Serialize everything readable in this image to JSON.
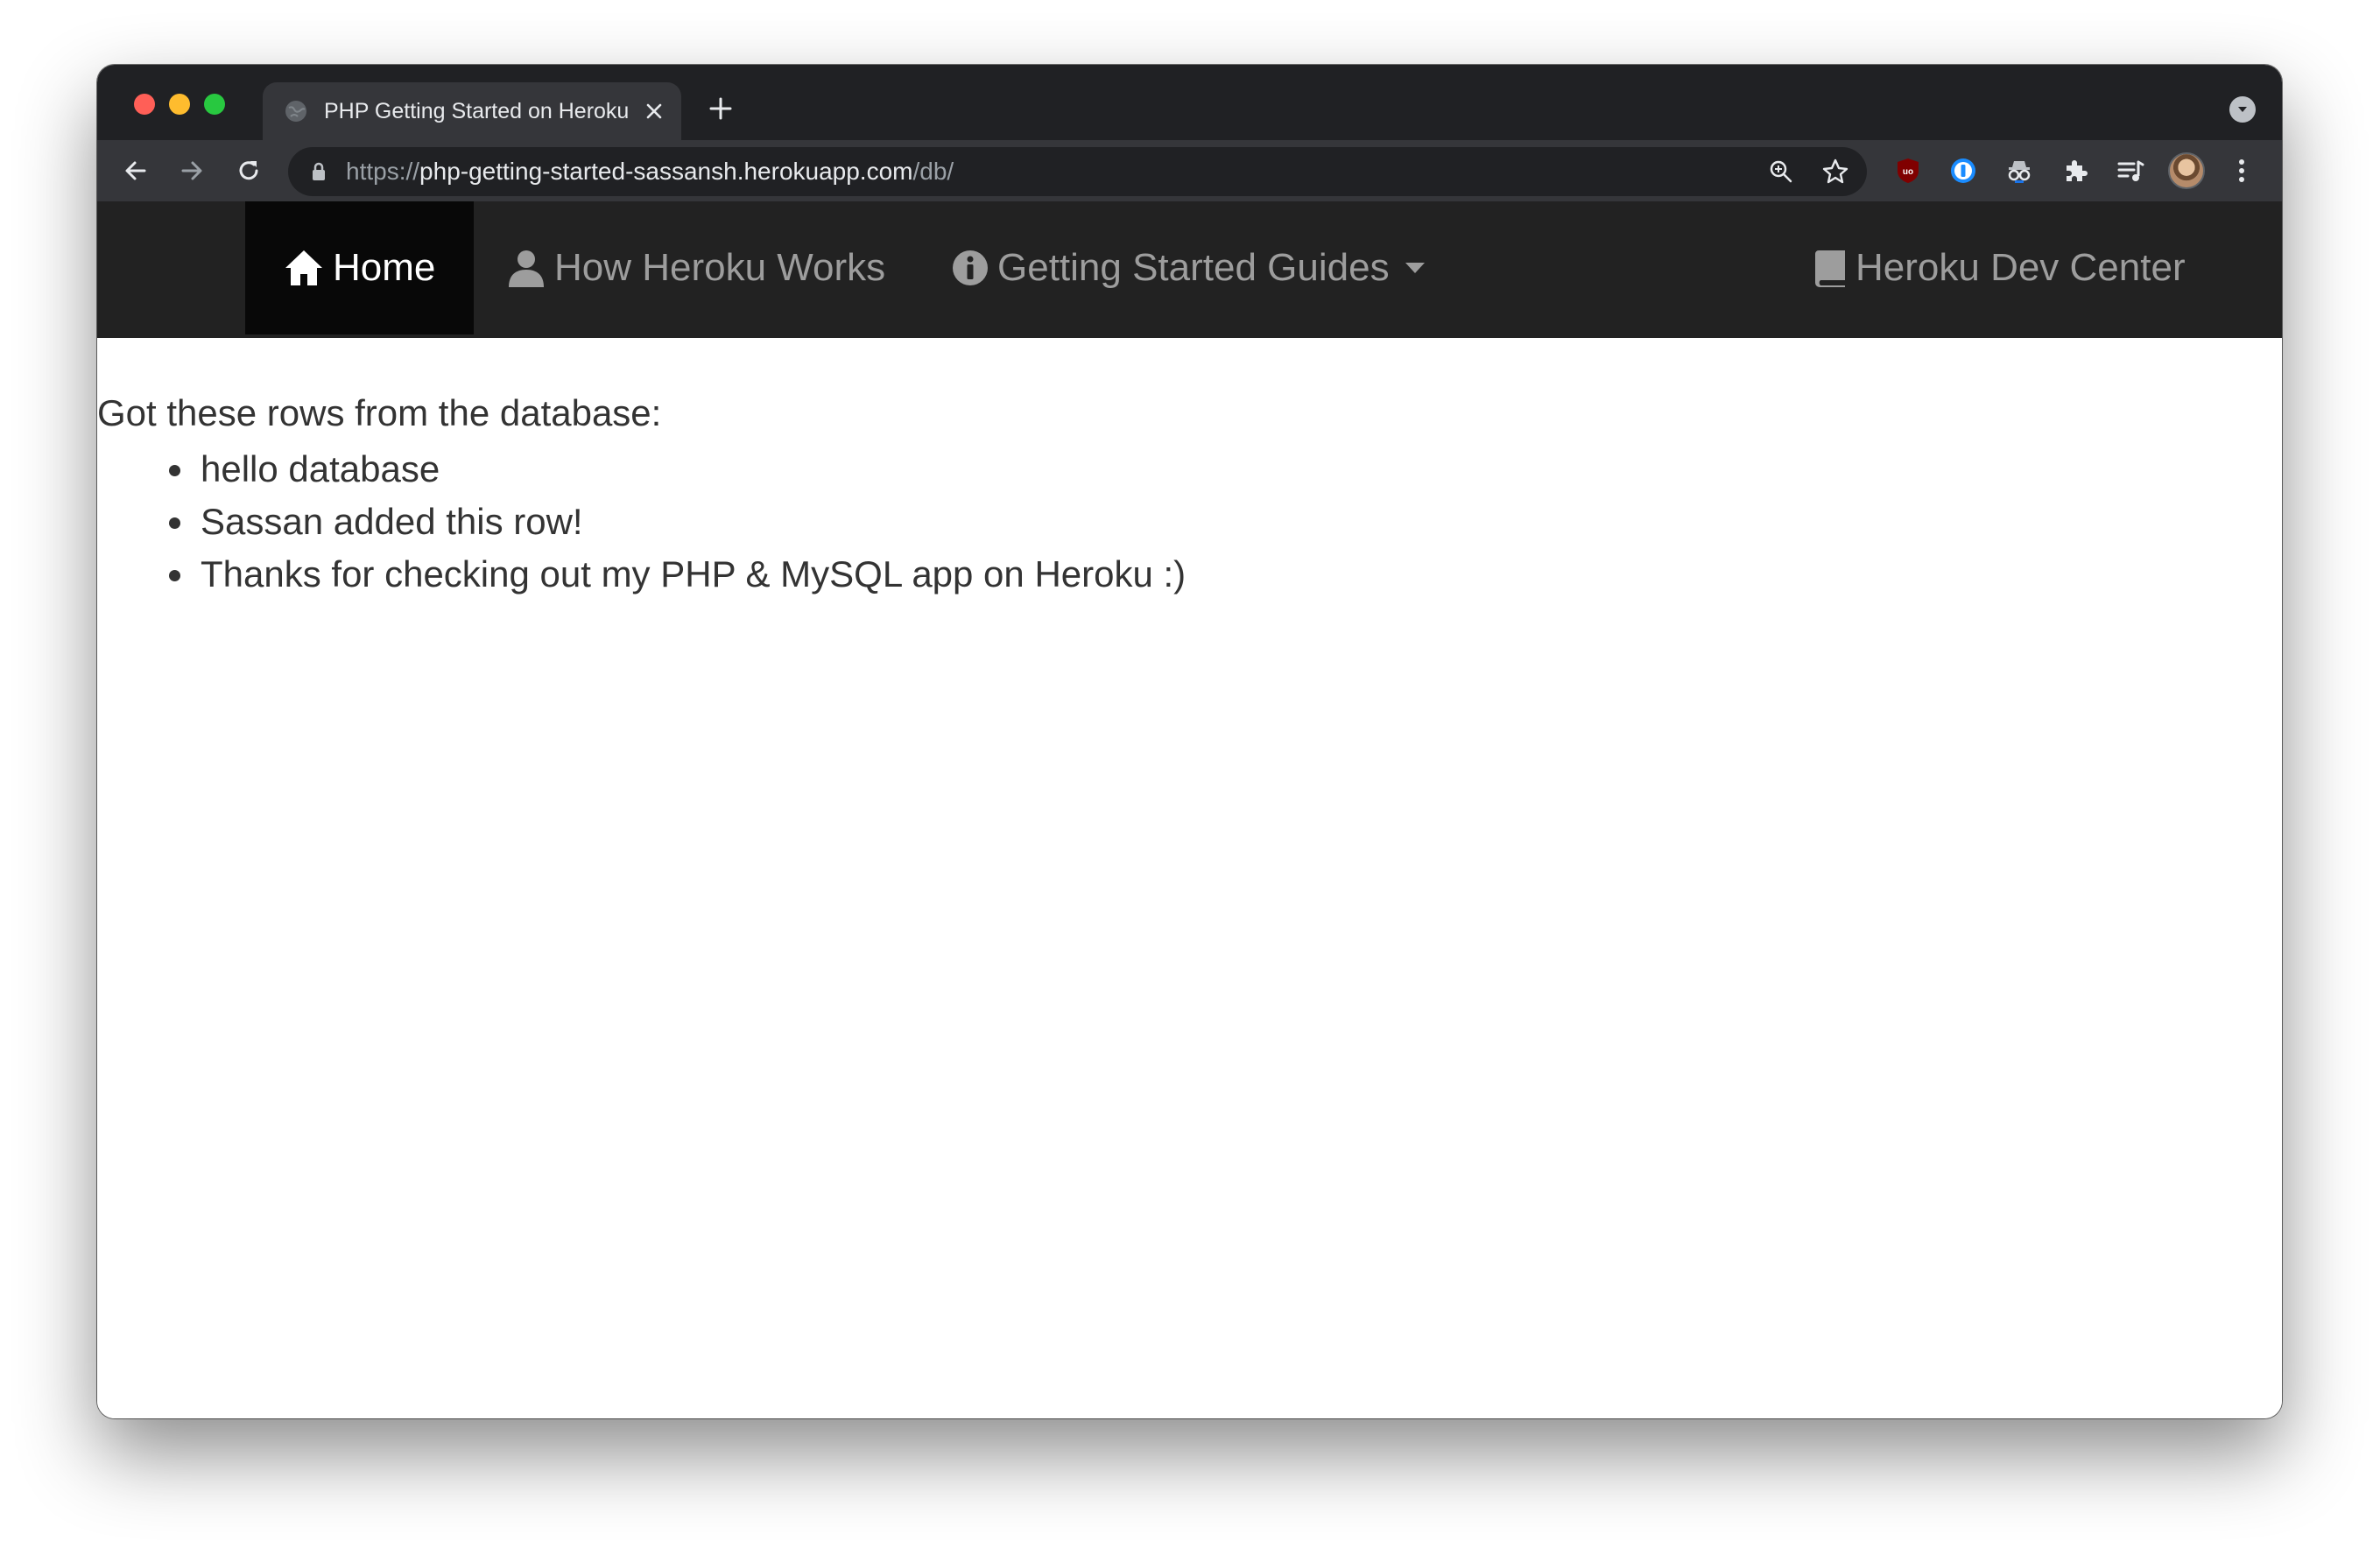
{
  "browser": {
    "tab_title": "PHP Getting Started on Heroku",
    "url_scheme": "https://",
    "url_host": "php-getting-started-sassansh.herokuapp.com",
    "url_path": "/db/",
    "icons": [
      "back-icon",
      "forward-icon",
      "reload-icon",
      "lock-icon",
      "zoom-icon",
      "star-icon",
      "ublock-icon",
      "onepassword-icon",
      "spy-icon",
      "puzzle-icon",
      "reading-list-icon",
      "avatar",
      "more-icon"
    ]
  },
  "navbar": {
    "home_label": "Home",
    "how_label": "How Heroku Works",
    "guides_label": "Getting Started Guides",
    "devcenter_label": "Heroku Dev Center"
  },
  "content": {
    "lead": "Got these rows from the database:",
    "rows": [
      "hello database",
      "Sassan added this row!",
      "Thanks for checking out my PHP & MySQL app on Heroku :)"
    ]
  }
}
